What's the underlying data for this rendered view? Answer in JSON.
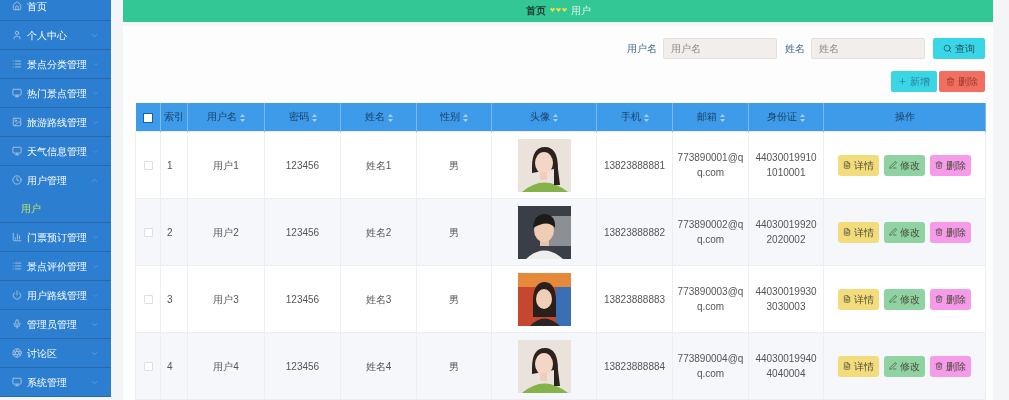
{
  "sidebar": {
    "items": [
      {
        "label": "首页"
      },
      {
        "label": "个人中心",
        "expanded": false
      },
      {
        "label": "景点分类管理",
        "expanded": false
      },
      {
        "label": "热门景点管理",
        "expanded": false
      },
      {
        "label": "旅游路线管理",
        "expanded": false
      },
      {
        "label": "天气信息管理",
        "expanded": false
      },
      {
        "label": "用户管理",
        "expanded": true,
        "children": [
          {
            "label": "用户",
            "selected": true
          }
        ]
      },
      {
        "label": "门票预订管理",
        "expanded": false
      },
      {
        "label": "景点评价管理",
        "expanded": false
      },
      {
        "label": "用户路线管理",
        "expanded": false
      },
      {
        "label": "管理员管理",
        "expanded": false
      },
      {
        "label": "讨论区",
        "expanded": false
      },
      {
        "label": "系统管理",
        "expanded": false
      }
    ]
  },
  "breadcrumb": [
    {
      "label": "首页",
      "current": false
    },
    {
      "label": "用户",
      "current": true
    }
  ],
  "filters": [
    {
      "label": "用户名",
      "placeholder": "用户名"
    },
    {
      "label": "姓名",
      "placeholder": "姓名"
    }
  ],
  "search_button": "查询",
  "toolbar": [
    {
      "kind": "add",
      "label": "新增"
    },
    {
      "kind": "delete",
      "label": "删除"
    }
  ],
  "table": {
    "select_all": false,
    "columns": [
      {
        "label": "索引",
        "sortable": false
      },
      {
        "label": "用户名",
        "sortable": true
      },
      {
        "label": "密码",
        "sortable": true
      },
      {
        "label": "姓名",
        "sortable": true
      },
      {
        "label": "性别",
        "sortable": true
      },
      {
        "label": "头像",
        "sortable": true
      },
      {
        "label": "手机",
        "sortable": true
      },
      {
        "label": "邮箱",
        "sortable": true
      },
      {
        "label": "身份证",
        "sortable": true
      },
      {
        "label": "操作",
        "sortable": false
      }
    ],
    "rows": [
      {
        "checked": false,
        "index": "1",
        "username": "用户1",
        "password": "123456",
        "name": "姓名1",
        "gender": "男",
        "photo": {
          "kind": "picture"
        },
        "phone": "13823888881",
        "email": "773890001@qq.com",
        "id_card": "440300199101010001",
        "actions": [
          {
            "kind": "detail",
            "label": "详情"
          },
          {
            "kind": "edit",
            "label": "修改"
          },
          {
            "kind": "delete",
            "label": "删除"
          }
        ]
      },
      {
        "checked": false,
        "index": "2",
        "username": "用户2",
        "password": "123456",
        "name": "姓名2",
        "gender": "男",
        "photo": {
          "kind": "picture"
        },
        "phone": "13823888882",
        "email": "773890002@qq.com",
        "id_card": "440300199202020002",
        "actions": [
          {
            "kind": "detail",
            "label": "详情"
          },
          {
            "kind": "edit",
            "label": "修改"
          },
          {
            "kind": "delete",
            "label": "删除"
          }
        ]
      },
      {
        "checked": false,
        "index": "3",
        "username": "用户3",
        "password": "123456",
        "name": "姓名3",
        "gender": "男",
        "photo": {
          "kind": "picture"
        },
        "phone": "13823888883",
        "email": "773890003@qq.com",
        "id_card": "440300199303030003",
        "actions": [
          {
            "kind": "detail",
            "label": "详情"
          },
          {
            "kind": "edit",
            "label": "修改"
          },
          {
            "kind": "delete",
            "label": "删除"
          }
        ]
      },
      {
        "checked": false,
        "index": "4",
        "username": "用户4",
        "password": "123456",
        "name": "姓名4",
        "gender": "男",
        "photo": {
          "kind": "picture"
        },
        "phone": "13823888884",
        "email": "773890004@qq.com",
        "id_card": "440300199404040004",
        "actions": [
          {
            "kind": "detail",
            "label": "详情"
          },
          {
            "kind": "edit",
            "label": "修改"
          },
          {
            "kind": "delete",
            "label": "删除"
          }
        ]
      }
    ]
  }
}
